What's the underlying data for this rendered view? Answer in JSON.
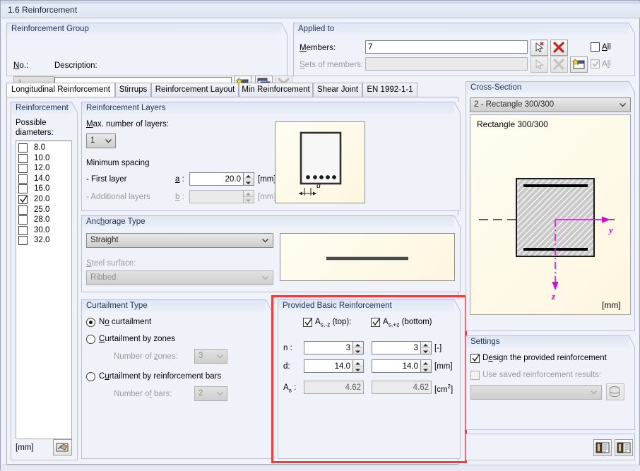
{
  "window": {
    "title": "1.6 Reinforcement"
  },
  "reinforcement_group": {
    "legend": "Reinforcement Group",
    "no_label": "No.:",
    "no_value": "1",
    "description_label": "Description:",
    "description_value": "",
    "buttons": [
      {
        "name": "new-reinforcement-group",
        "icon": "new-window-icon",
        "enabled": true
      },
      {
        "name": "copy-reinforcement-group",
        "icon": "copy-window-icon",
        "enabled": true
      },
      {
        "name": "delete-reinforcement-group",
        "icon": "delete-x-icon",
        "enabled": false
      }
    ]
  },
  "applied_to": {
    "legend": "Applied to",
    "members_label": "Members:",
    "members_value": "7",
    "sets_label": "Sets of members:",
    "sets_value": "",
    "all_label_1": "All",
    "all_label_2": "All",
    "all_checked_1": false,
    "all_checked_2": true,
    "buttons": [
      {
        "name": "pick-members-button",
        "icon": "pick-cursor-icon",
        "enabled": true
      },
      {
        "name": "clear-members-button",
        "icon": "red-x-icon",
        "enabled": true
      },
      {
        "name": "pick-sets-button",
        "icon": "pick-cursor-icon",
        "enabled": false
      },
      {
        "name": "clear-sets-button",
        "icon": "gray-x-icon",
        "enabled": false
      },
      {
        "name": "new-set-button",
        "icon": "new-window-icon",
        "enabled": true
      }
    ]
  },
  "tabs": [
    {
      "label": "Longitudinal Reinforcement",
      "active": true
    },
    {
      "label": "Stirrups",
      "active": false
    },
    {
      "label": "Reinforcement Layout",
      "active": false
    },
    {
      "label": "Min Reinforcement",
      "active": false
    },
    {
      "label": "Shear Joint",
      "active": false
    },
    {
      "label": "EN 1992-1-1",
      "active": false
    }
  ],
  "reinforcement_panel": {
    "legend": "Reinforcement",
    "possible_diameters_label_1": "Possible",
    "possible_diameters_label_2": "diameters:",
    "diameters": [
      {
        "value": "8.0",
        "checked": false
      },
      {
        "value": "10.0",
        "checked": false
      },
      {
        "value": "12.0",
        "checked": false
      },
      {
        "value": "14.0",
        "checked": false
      },
      {
        "value": "16.0",
        "checked": false
      },
      {
        "value": "20.0",
        "checked": true
      },
      {
        "value": "25.0",
        "checked": false
      },
      {
        "value": "28.0",
        "checked": false
      },
      {
        "value": "30.0",
        "checked": false
      },
      {
        "value": "32.0",
        "checked": false
      }
    ],
    "unit": "[mm]",
    "settings_button": "diameter-settings-icon"
  },
  "reinforcement_layers": {
    "legend": "Reinforcement Layers",
    "max_layers_label": "Max. number of layers:",
    "max_layers_value": "1",
    "min_spacing_label": "Minimum spacing",
    "first_layer_label": "- First layer",
    "first_layer_symbol": "a :",
    "first_layer_value": "20.0",
    "first_layer_unit": "[mm]",
    "additional_layers_label": "- Additional layers",
    "additional_layers_symbol": "b :",
    "additional_layers_value": "",
    "additional_layers_unit": "[mm]",
    "diagram_label": "a"
  },
  "anchorage_type": {
    "legend": "Anchorage Type",
    "type_value": "Straight",
    "steel_surface_label": "Steel surface:",
    "steel_surface_value": "Ribbed"
  },
  "curtailment_type": {
    "legend": "Curtailment Type",
    "options": [
      {
        "label": "No curtailment",
        "selected": true
      },
      {
        "label": "Curtailment by zones",
        "selected": false
      },
      {
        "label": "Curtailment by reinforcement bars",
        "selected": false
      }
    ],
    "zones_label": "Number of zones:",
    "zones_value": "3",
    "bars_label": "Number of bars:",
    "bars_value": "2"
  },
  "provided_basic_reinforcement": {
    "legend": "Provided Basic Reinforcement",
    "highlight_color": "#f43b3b",
    "col_top": {
      "label_main": "A",
      "label_sub": "s,-z",
      "label_rest": " (top):",
      "checked": true
    },
    "col_bottom": {
      "label_main": "A",
      "label_sub": "s,+z",
      "label_rest": " (bottom)",
      "checked": true
    },
    "rows": [
      {
        "key": "n :",
        "top": "3",
        "bottom": "3",
        "unit": "[-]",
        "readonly": false
      },
      {
        "key": "d:",
        "top": "14.0",
        "bottom": "14.0",
        "unit": "[mm]",
        "readonly": false
      }
    ],
    "as_row": {
      "key_main": "A",
      "key_sub": "s",
      "key_rest": " :",
      "top": "4.62",
      "bottom": "4.62",
      "unit_main": "[cm",
      "unit_sup": "2",
      "unit_end": "]"
    }
  },
  "cross_section": {
    "legend": "Cross-Section",
    "selected": "2 - Rectangle 300/300",
    "drawing_title": "Rectangle 300/300",
    "axis_y": "y",
    "axis_z": "z",
    "unit": "[mm]",
    "axis_color": "#e000e0"
  },
  "settings": {
    "legend": "Settings",
    "design_provided_label": "Design the provided reinforcement",
    "design_provided_checked": true,
    "use_saved_label": "Use saved reinforcement results:",
    "use_saved_checked": false,
    "saved_value": "",
    "saved_button": "database-icon"
  },
  "bottom_buttons": [
    {
      "name": "details-button-1",
      "icon": "report-icon"
    },
    {
      "name": "details-button-2",
      "icon": "report-icon"
    }
  ]
}
